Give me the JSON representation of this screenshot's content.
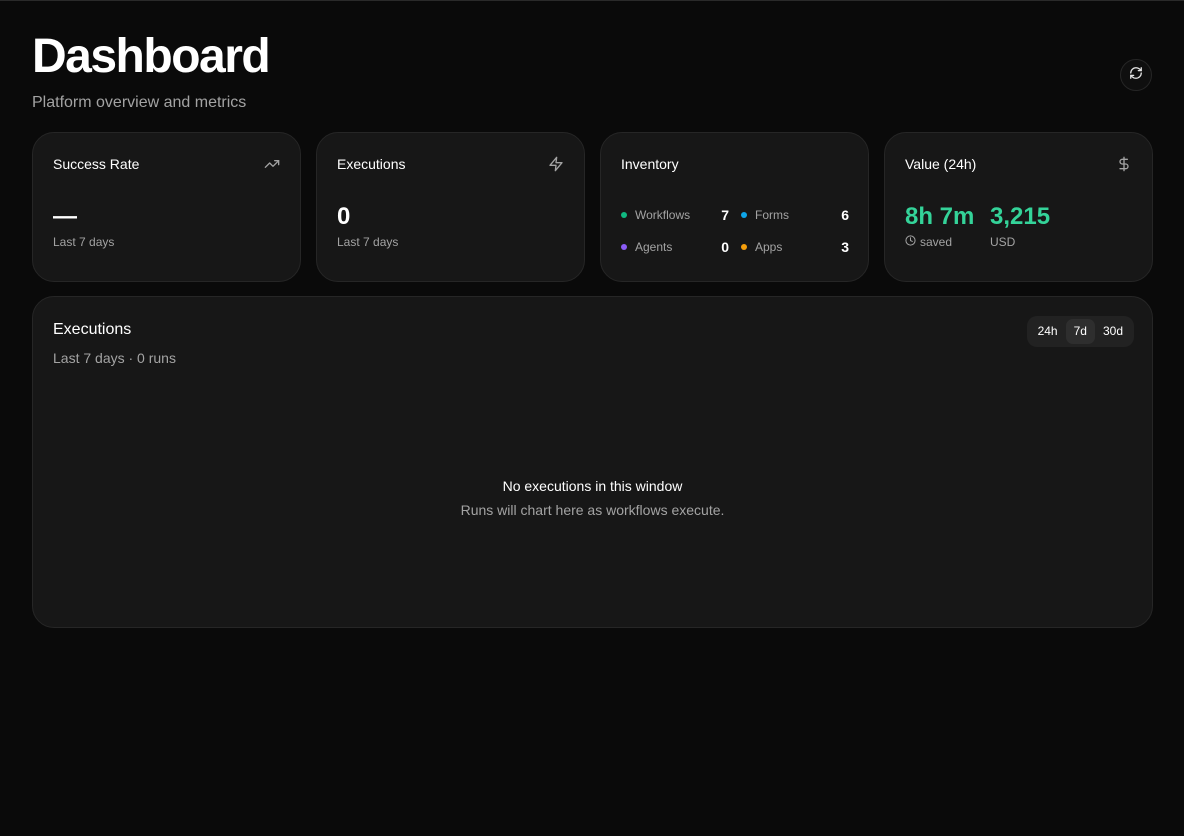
{
  "header": {
    "title": "Dashboard",
    "subtitle": "Platform overview and metrics",
    "refresh_icon": "refresh-icon"
  },
  "cards": {
    "success_rate": {
      "title": "Success Rate",
      "value": "—",
      "caption": "Last 7 days",
      "icon": "trending-up-icon"
    },
    "executions": {
      "title": "Executions",
      "value": "0",
      "caption": "Last 7 days",
      "icon": "zap-icon"
    },
    "inventory": {
      "title": "Inventory",
      "items": [
        {
          "label": "Workflows",
          "count": "7",
          "color": "#10b981"
        },
        {
          "label": "Forms",
          "count": "6",
          "color": "#0ea5e9"
        },
        {
          "label": "Agents",
          "count": "0",
          "color": "#8b5cf6"
        },
        {
          "label": "Apps",
          "count": "3",
          "color": "#f59e0b"
        }
      ]
    },
    "value": {
      "title": "Value (24h)",
      "icon": "dollar-icon",
      "time_value": "8h 7m",
      "time_caption": "saved",
      "money_value": "3,215",
      "money_caption": "USD",
      "accent": "#34d399"
    }
  },
  "executions_panel": {
    "title": "Executions",
    "subtitle": "Last 7 days · 0 runs",
    "ranges": [
      "24h",
      "7d",
      "30d"
    ],
    "selected_range": "7d",
    "empty_title": "No executions in this window",
    "empty_subtitle": "Runs will chart here as workflows execute."
  }
}
